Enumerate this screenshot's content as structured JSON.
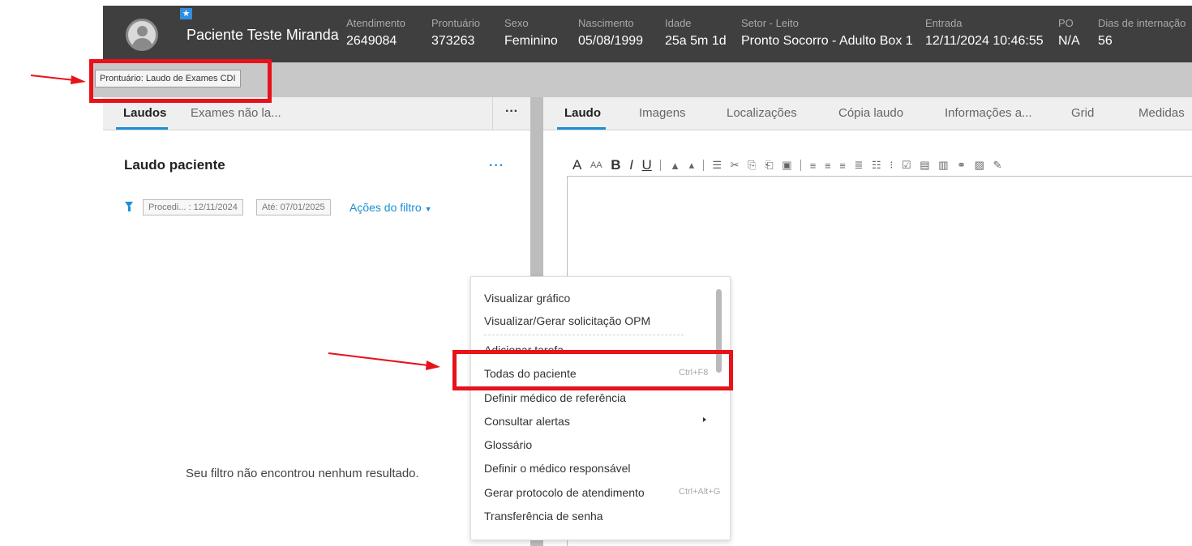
{
  "header": {
    "patient_name": "Paciente Teste Miranda",
    "fields": [
      {
        "label": "Atendimento",
        "value": "2649084"
      },
      {
        "label": "Prontuário",
        "value": "373263"
      },
      {
        "label": "Sexo",
        "value": "Feminino"
      },
      {
        "label": "Nascimento",
        "value": "05/08/1999"
      },
      {
        "label": "Idade",
        "value": "25a 5m 1d"
      },
      {
        "label": "Setor - Leito",
        "value": "Pronto Socorro - Adulto Box 1"
      },
      {
        "label": "Entrada",
        "value": "12/11/2024 10:46:55"
      },
      {
        "label": "PO",
        "value": "N/A"
      },
      {
        "label": "Dias de internação",
        "value": "56"
      }
    ]
  },
  "tooltip": "Prontuário: Laudo de Exames CDI",
  "left_panel": {
    "tabs": [
      "Laudos",
      "Exames não la..."
    ],
    "title": "Laudo paciente",
    "filter_chips": [
      "Procedi... : 12/11/2024",
      "Até: 07/01/2025"
    ],
    "filter_actions": "Ações do filtro",
    "empty_message": "Seu filtro não encontrou nenhum resultado."
  },
  "right_panel": {
    "tabs": [
      "Laudo",
      "Imagens",
      "Localizações",
      "Cópia laudo",
      "Informações a...",
      "Grid",
      "Medidas"
    ]
  },
  "context_menu": {
    "items": [
      {
        "label": "Visualizar gráfico",
        "shortcut": ""
      },
      {
        "label": "Visualizar/Gerar solicitação OPM",
        "shortcut": ""
      },
      {
        "label": "Adicionar tarefa",
        "shortcut": ""
      },
      {
        "label": "Todas do paciente",
        "shortcut": "Ctrl+F8"
      },
      {
        "label": "Definir médico de referência",
        "shortcut": ""
      },
      {
        "label": "Consultar alertas",
        "shortcut": ""
      },
      {
        "label": "Glossário",
        "shortcut": ""
      },
      {
        "label": "Definir o médico responsável",
        "shortcut": ""
      },
      {
        "label": "Gerar protocolo de atendimento",
        "shortcut": "Ctrl+Alt+G"
      },
      {
        "label": "Transferência de senha",
        "shortcut": ""
      }
    ]
  },
  "colors": {
    "header_bg": "#3f3f3f",
    "accent": "#1a8fd6",
    "annotation_red": "#e8121a"
  }
}
